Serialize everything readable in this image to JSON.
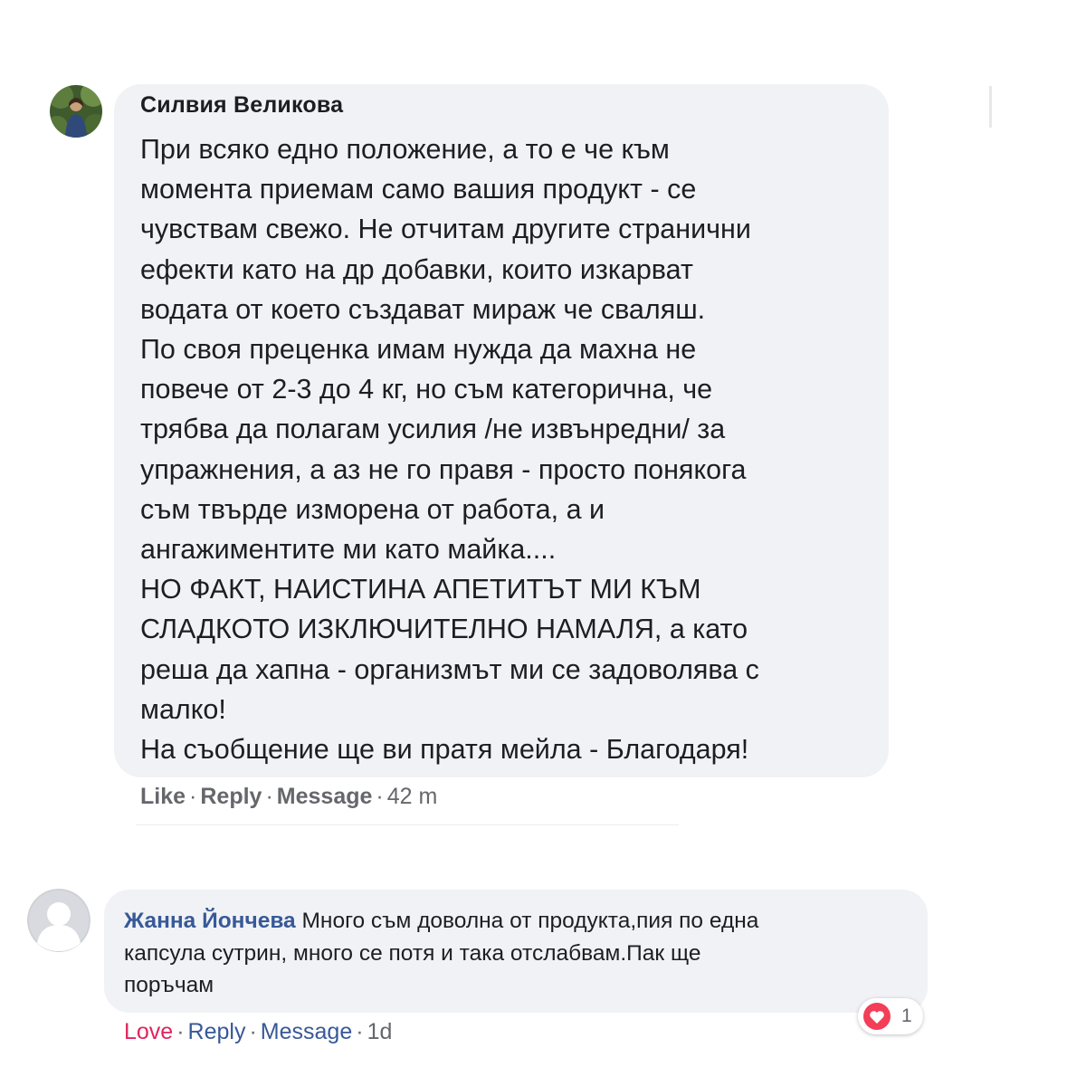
{
  "comment1": {
    "author": "Силвия Великова",
    "lines": [
      "При всяко едно положение, а то е че към",
      "момента приемам само вашия продукт - се",
      "чувствам свежо. Не отчитам другите странични",
      "ефекти като на др добавки, които изкарват",
      "водата от което създават мираж че сваляш.",
      "По своя преценка имам нужда да махна не",
      "повече от 2-3 до 4 кг, но съм категорична, че",
      "трябва да полагам усилия /не извънредни/ за",
      "упражнения, а аз не го правя - просто понякога",
      "съм твърде изморена от работа, а и",
      "ангажиментите ми като майка....",
      "НО ФАКТ, НАИСТИНА АПЕТИТЪТ МИ КЪМ",
      "СЛАДКОТО ИЗКЛЮЧИТЕЛНО НАМАЛЯ, а като",
      "реша да хапна - организмът ми се задоволява с",
      "малко!",
      "На съобщение ще ви пратя мейла - Благодаря!"
    ],
    "actions": {
      "like": "Like",
      "reply": "Reply",
      "message": "Message",
      "time": "42 m",
      "sep": "·"
    }
  },
  "comment2": {
    "author": "Жанна Йончева",
    "lines": [
      "Много съм доволна от продукта,пия по една",
      "капсула сутрин, много се потя и така отслабвам.Пак ще",
      "поръчам"
    ],
    "actions": {
      "love": "Love",
      "reply": "Reply",
      "message": "Message",
      "time": "1d",
      "sep": "·"
    },
    "reaction_count": "1",
    "reaction_icon": "heart-icon"
  },
  "colors": {
    "bubble": "#f0f2f5",
    "name_link": "#385898",
    "love": "#e0245e",
    "meta": "#65676b"
  }
}
